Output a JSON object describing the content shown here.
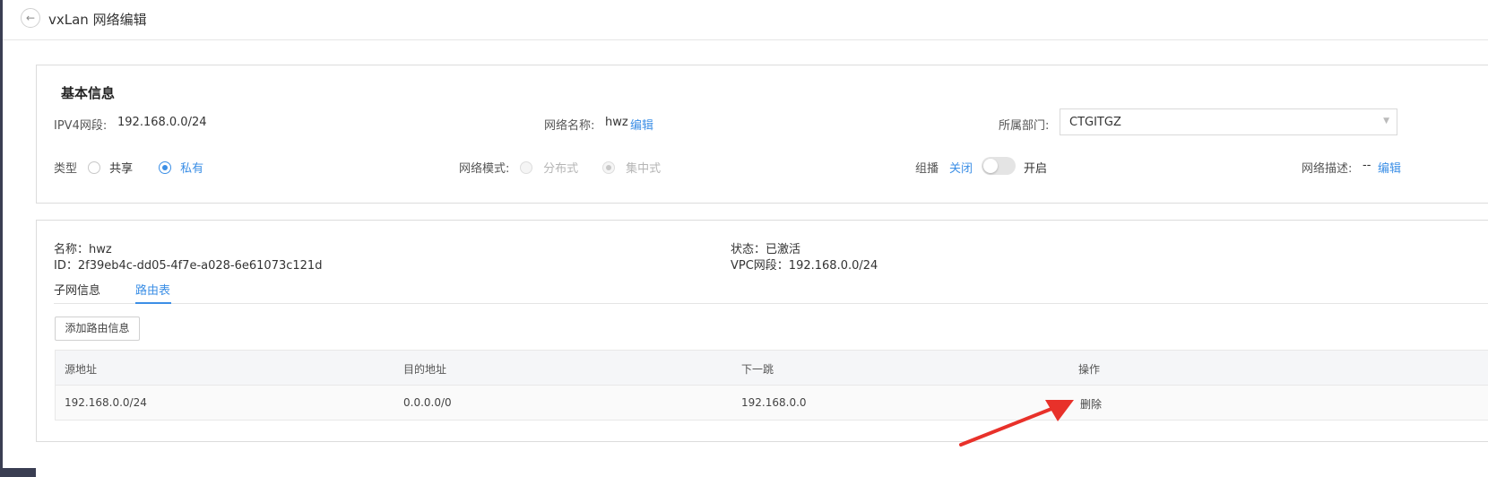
{
  "header": {
    "title": "vxLan 网络编辑",
    "back_icon": "arrow-left-icon"
  },
  "basic": {
    "section_title": "基本信息",
    "ipv4_label": "IPV4网段:",
    "ipv4_value": "192.168.0.0/24",
    "name_label": "网络名称:",
    "name_value": "hwz",
    "name_edit": "编辑",
    "dept_label": "所属部门:",
    "dept_value": "CTGITGZ",
    "type_label": "类型",
    "type_shared": "共享",
    "type_private": "私有",
    "type_selected": "私有",
    "mode_label": "网络模式:",
    "mode_distributed": "分布式",
    "mode_centralized": "集中式",
    "mode_selected": "集中式",
    "multicast_label": "组播",
    "multicast_off": "关闭",
    "multicast_on": "开启",
    "multicast_state": "关闭",
    "desc_label": "网络描述:",
    "desc_value": "--",
    "desc_edit": "编辑"
  },
  "detail": {
    "name_line": "名称：hwz",
    "id_line": "ID：2f39eb4c-dd05-4f7e-a028-6e61073c121d",
    "status_line": "状态：已激活",
    "vpc_line": "VPC网段：192.168.0.0/24",
    "tabs": [
      {
        "label": "子网信息"
      },
      {
        "label": "路由表"
      }
    ],
    "active_tab": "路由表",
    "add_button": "添加路由信息",
    "table": {
      "headers": [
        "源地址",
        "目的地址",
        "下一跳",
        "操作"
      ],
      "rows": [
        {
          "source": "192.168.0.0/24",
          "dest": "0.0.0.0/0",
          "next_hop": "192.168.0.0",
          "action": "删除"
        }
      ]
    }
  },
  "colors": {
    "accent": "#3c8fe6",
    "annotation_arrow": "#e8312a",
    "sidebar": "#3a3e52"
  }
}
